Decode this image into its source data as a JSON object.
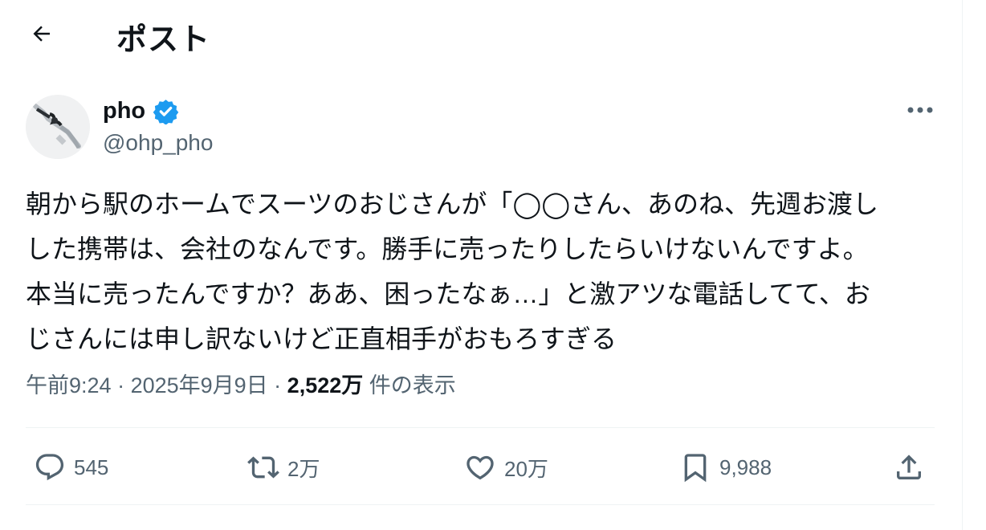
{
  "header": {
    "title": "ポスト",
    "back_icon": "arrow-left-icon"
  },
  "author": {
    "name": "pho",
    "handle": "@ohp_pho",
    "verified": true,
    "verified_color": "#1d9bf0"
  },
  "tweet": {
    "lines": [
      "朝から駅のホームでスーツのおじさんが「◯◯さん、あのね、先週お渡し",
      "した携帯は、会社のなんです。勝手に売ったりしたらいけないんですよ。",
      "本当に売ったんですか？ああ、困ったなぁ…」と激アツな電話してて、お",
      "じさんには申し訳ないけど正直相手がおもろすぎる"
    ]
  },
  "meta": {
    "time": "午前9:24",
    "separator": " · ",
    "date": "2025年9月9日",
    "views_count": "2,522万",
    "views_label": " 件の表示"
  },
  "actions": {
    "reply_count": "545",
    "retweet_count": "2万",
    "like_count": "20万",
    "bookmark_count": "9,988"
  },
  "colors": {
    "text": "#0f1419",
    "secondary": "#536471",
    "divider": "#eff3f4",
    "accent": "#1d9bf0"
  }
}
